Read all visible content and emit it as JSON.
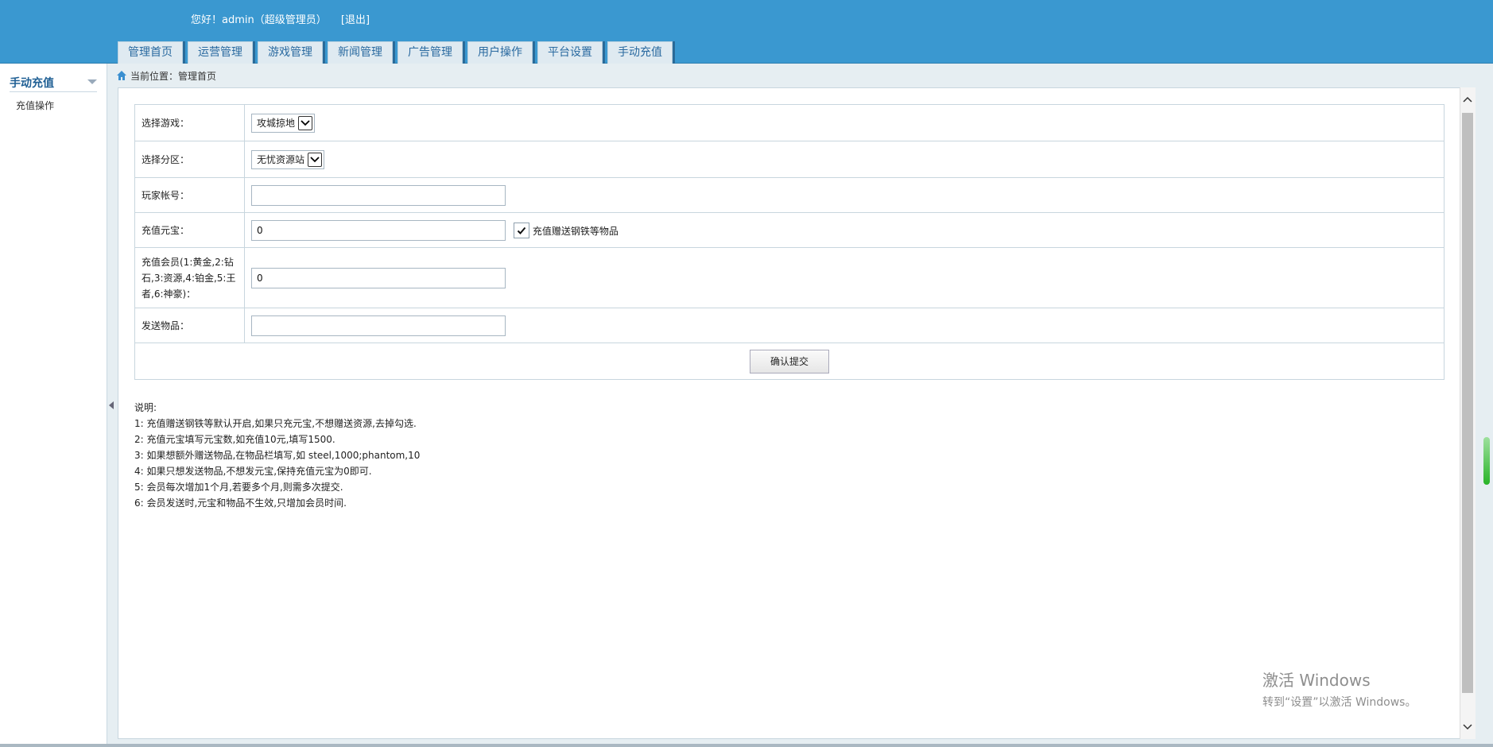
{
  "header": {
    "greeting": "您好！admin（超级管理员）",
    "logout": "[退出]"
  },
  "tabs": [
    {
      "label": "管理首页"
    },
    {
      "label": "运营管理"
    },
    {
      "label": "游戏管理"
    },
    {
      "label": "新闻管理"
    },
    {
      "label": "广告管理"
    },
    {
      "label": "用户操作"
    },
    {
      "label": "平台设置"
    },
    {
      "label": "手动充值"
    }
  ],
  "sidebar": {
    "title": "手动充值",
    "items": [
      {
        "label": "充值操作"
      }
    ]
  },
  "breadcrumb": "当前位置：管理首页",
  "form": {
    "game_label": "选择游戏：",
    "game_value": "攻城掠地",
    "zone_label": "选择分区：",
    "zone_value": "无忧资源站",
    "account_label": "玩家帐号：",
    "account_value": "",
    "yuanbao_label": "充值元宝：",
    "yuanbao_value": "0",
    "gift_checkbox_label": "充值赠送钢铁等物品",
    "gift_checked": true,
    "member_label": "充值会员(1:黄金,2:钻石,3:资源,4:铂金,5:王者,6:神豪)：",
    "member_value": "0",
    "items_label": "发送物品：",
    "items_value": "",
    "submit_label": "确认提交"
  },
  "notes": {
    "title": "说明:",
    "lines": [
      "1: 充值赠送钢铁等默认开启,如果只充元宝,不想赠送资源,去掉勾选.",
      "2: 充值元宝填写元宝数,如充值10元,填写1500.",
      "3: 如果想额外赠送物品,在物品栏填写,如 steel,1000;phantom,10",
      "4: 如果只想发送物品,不想发元宝,保持充值元宝为0即可.",
      "5: 会员每次增加1个月,若要多个月,则需多次提交.",
      "6: 会员发送时,元宝和物品不生效,只增加会员时间."
    ]
  },
  "watermark": {
    "line1": "激活 Windows",
    "line2": "转到“设置”以激活 Windows。"
  },
  "colors": {
    "header_bg": "#3a98d0",
    "tab_bg": "#dfeaf1",
    "accent": "#1f5f94"
  }
}
